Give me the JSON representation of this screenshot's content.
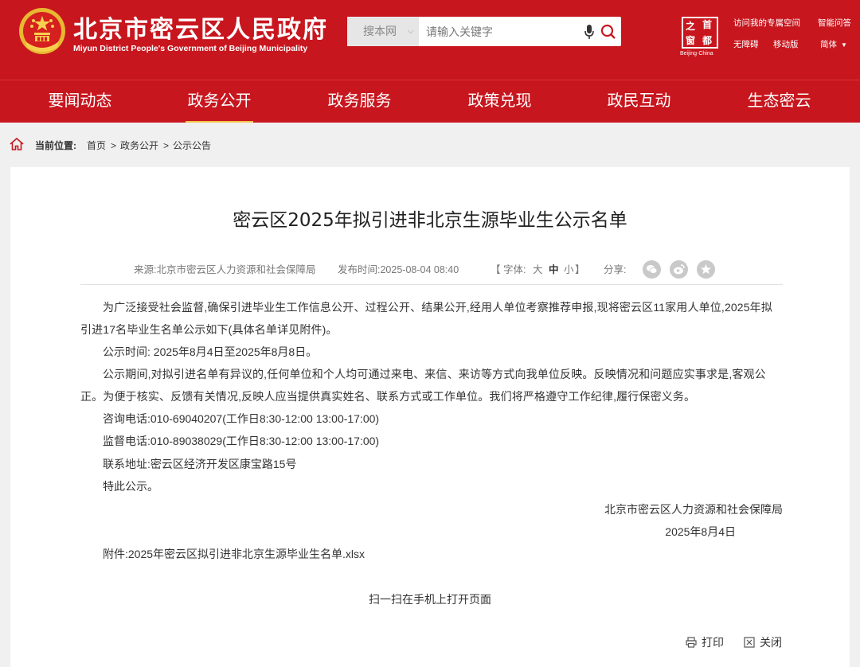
{
  "header": {
    "title": "北京市密云区人民政府",
    "subtitle": "Miyun District People's Government of Beijing Municipality",
    "search": {
      "scope": "搜本网",
      "placeholder": "请输入关键字"
    },
    "capital_logo": {
      "glyphs": [
        "之",
        "首",
        "窗",
        "都"
      ],
      "caption": "Beijing·China"
    },
    "links": {
      "my_space": "访问我的专属空间",
      "smart_qa": "智能问答",
      "accessible": "无障碍",
      "mobile": "移动版",
      "language": "简体"
    },
    "colors": {
      "brand_red": "#c8161e",
      "nav_underline": "#f5c24a"
    }
  },
  "nav": {
    "items": [
      {
        "label": "要闻动态"
      },
      {
        "label": "政务公开",
        "active": true
      },
      {
        "label": "政务服务"
      },
      {
        "label": "政策兑现"
      },
      {
        "label": "政民互动"
      },
      {
        "label": "生态密云"
      }
    ]
  },
  "breadcrumb": {
    "prefix": "当前位置:",
    "items": [
      "首页",
      "政务公开",
      "公示公告"
    ],
    "separator": ">"
  },
  "article": {
    "title": "密云区2025年拟引进非北京生源毕业生公示名单",
    "meta": {
      "source": "来源:北京市密云区人力资源和社会保障局",
      "date": "发布时间:2025-08-04 08:40",
      "font_label": "【 字体:",
      "font_large": "大",
      "font_medium": "中",
      "font_small": "小",
      "font_close": "】",
      "share_label": "分享:"
    },
    "paragraphs": {
      "intro": "为广泛接受社会监督,确保引进毕业生工作信息公开、过程公开、结果公开,经用人单位考察推荐申报,现将密云区11家用人单位,2025年拟引进17名毕业生名单公示如下(具体名单详见附件)。",
      "period": "公示时间:  2025年8月4日至2025年8月8日。",
      "objection": "公示期间,对拟引进名单有异议的,任何单位和个人均可通过来电、来信、来访等方式向我单位反映。反映情况和问题应实事求是,客观公正。为便于核实、反馈有关情况,反映人应当提供真实姓名、联系方式或工作单位。我们将严格遵守工作纪律,履行保密义务。",
      "consult_phone": "咨询电话:010-69040207(工作日8:30-12:00 13:00-17:00)",
      "supervise_phone": "监督电话:010-89038029(工作日8:30-12:00 13:00-17:00)",
      "address": "联系地址:密云区经济开发区康宝路15号",
      "closing": "特此公示。"
    },
    "signature": {
      "org": "北京市密云区人力资源和社会保障局",
      "date": "2025年8月4日"
    },
    "attachment": "附件:2025年密云区拟引进非北京生源毕业生名单.xlsx",
    "qr_text": "扫一扫在手机上打开页面",
    "tools": {
      "print": "打印",
      "close": "关闭"
    }
  }
}
